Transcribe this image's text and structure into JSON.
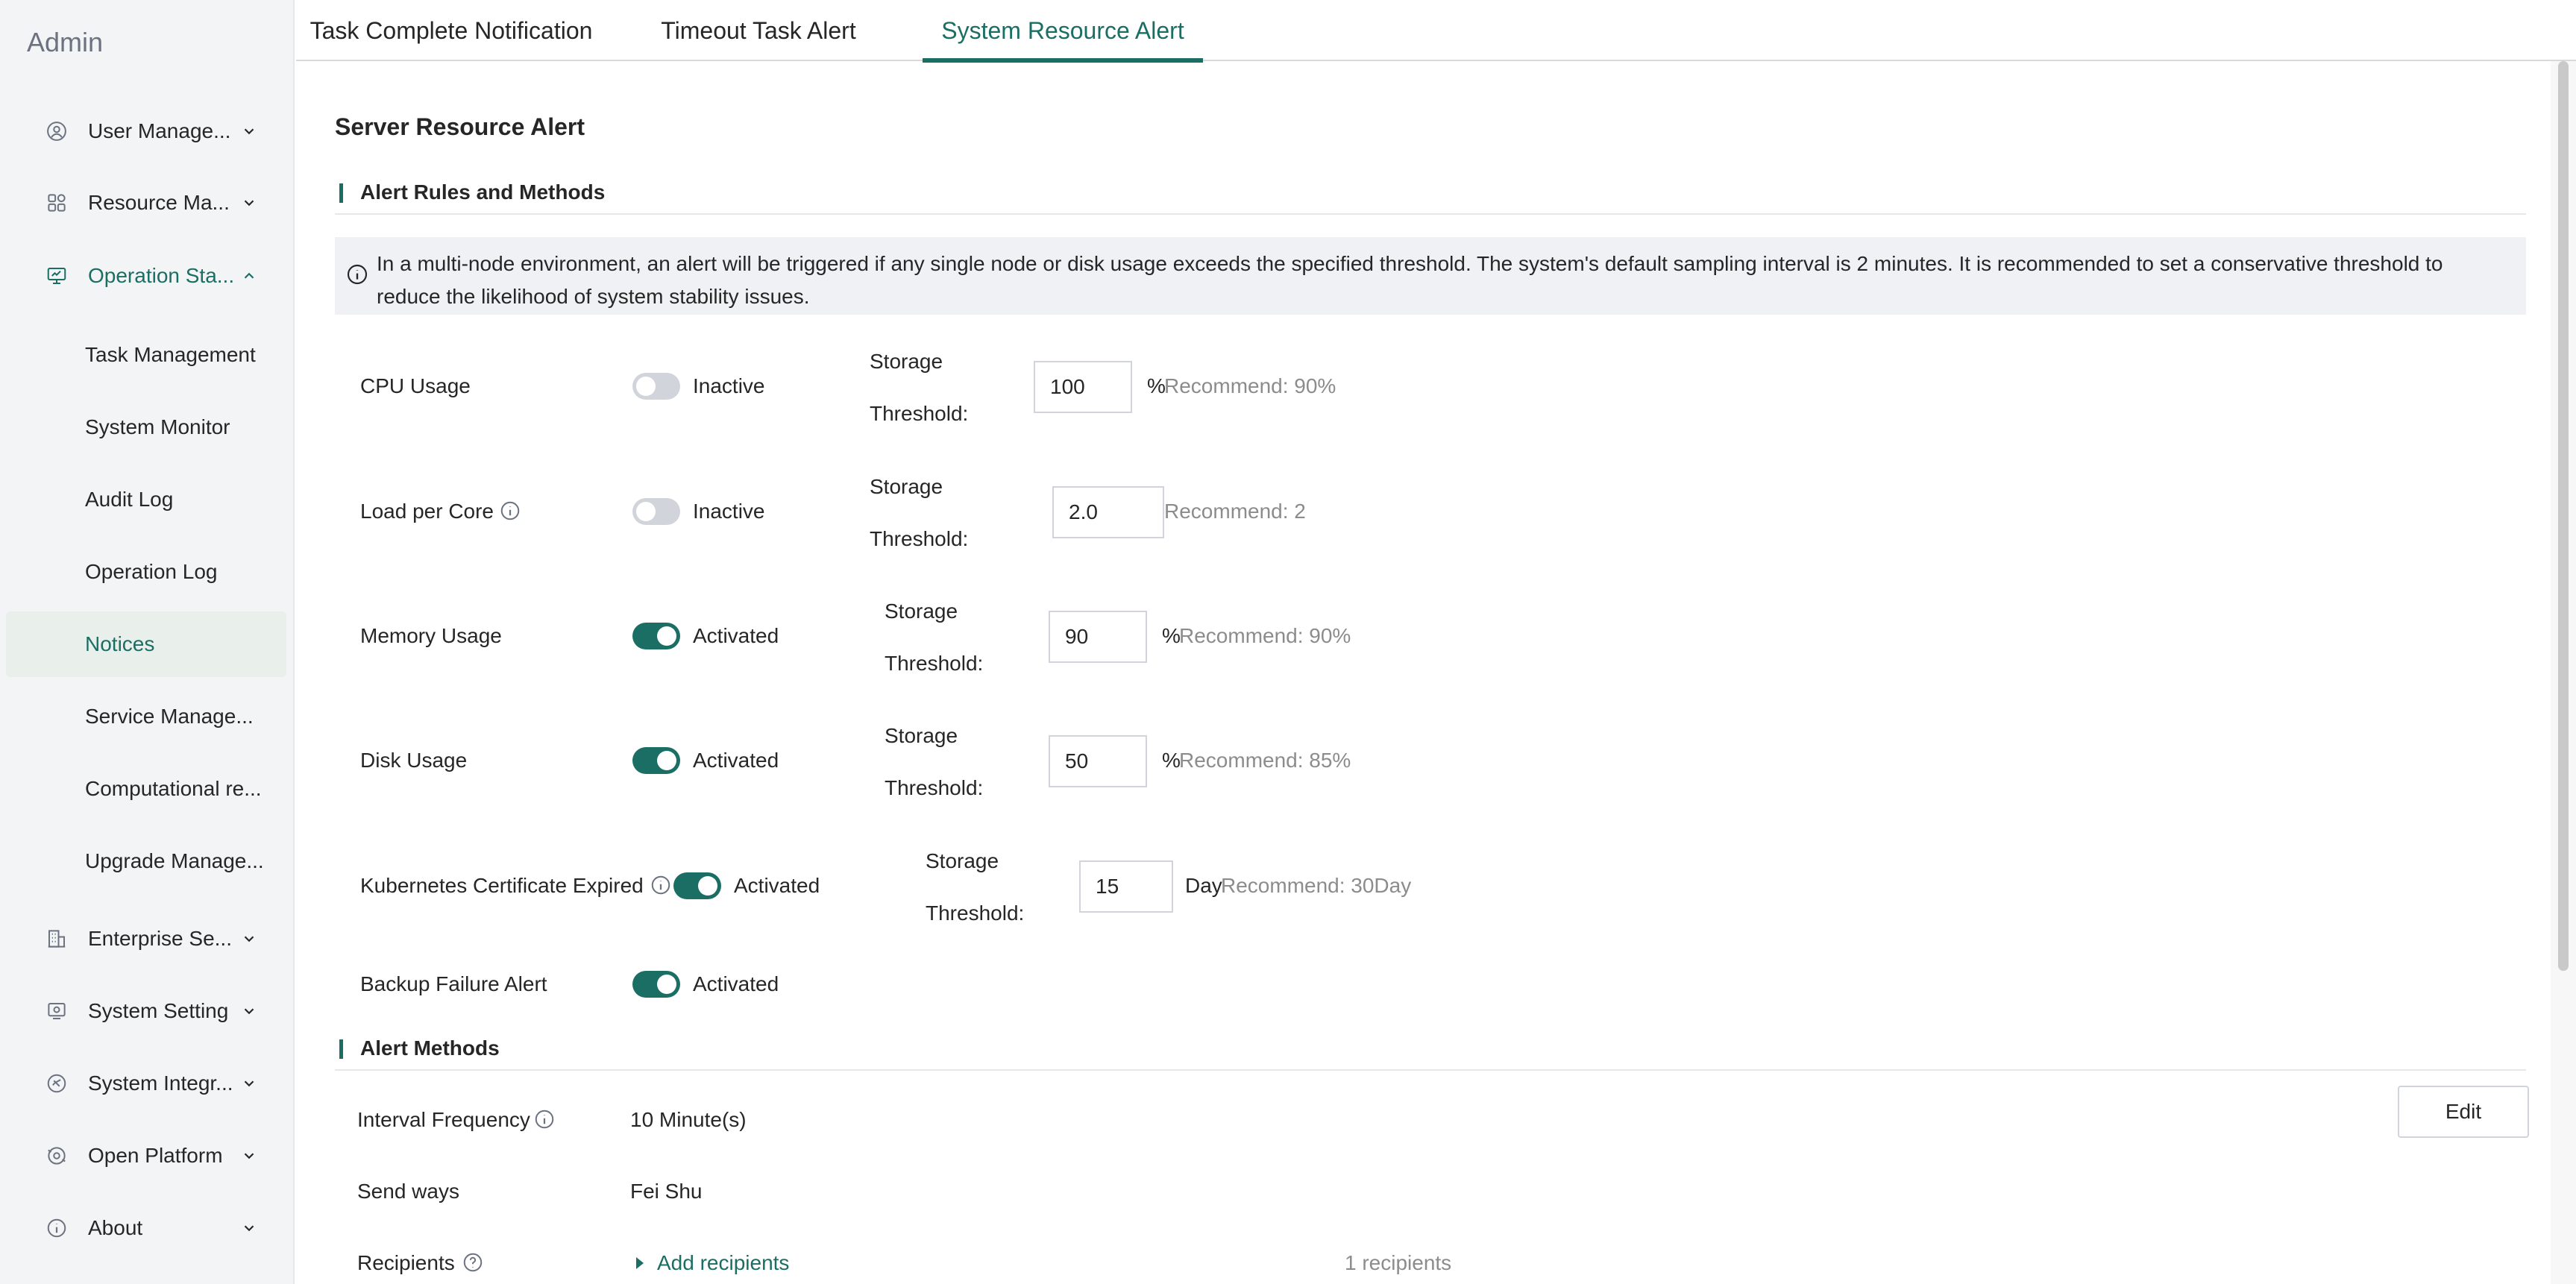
{
  "sidebar": {
    "brand": "Admin",
    "items": [
      {
        "label": "User Manage...",
        "icon": "user-circle-icon",
        "expanded": false
      },
      {
        "label": "Resource Ma...",
        "icon": "grid-icon",
        "expanded": false
      },
      {
        "label": "Operation Sta...",
        "icon": "monitor-icon",
        "expanded": true
      },
      {
        "label": "Enterprise Se...",
        "icon": "building-icon",
        "expanded": false
      },
      {
        "label": "System Setting",
        "icon": "gear-icon",
        "expanded": false
      },
      {
        "label": "System Integr...",
        "icon": "integration-icon",
        "expanded": false
      },
      {
        "label": "Open Platform",
        "icon": "platform-icon",
        "expanded": false
      },
      {
        "label": "About",
        "icon": "info-icon",
        "expanded": false
      }
    ],
    "sub_items": [
      {
        "label": "Task Management"
      },
      {
        "label": "System Monitor"
      },
      {
        "label": "Audit Log"
      },
      {
        "label": "Operation Log"
      },
      {
        "label": "Notices",
        "active": true
      },
      {
        "label": "Service Manage..."
      },
      {
        "label": "Computational re..."
      },
      {
        "label": "Upgrade Manage..."
      }
    ]
  },
  "tabs": [
    {
      "label": "Task Complete Notification"
    },
    {
      "label": "Timeout Task Alert"
    },
    {
      "label": "System Resource Alert",
      "active": true
    }
  ],
  "page": {
    "title": "Server Resource Alert",
    "rules_section": "Alert Rules and Methods",
    "banner": "In a multi-node environment, an alert will be triggered if any single node or disk usage exceeds the specified threshold. The system's default sampling interval is 2 minutes. It is recommended to set a conservative threshold to reduce the likelihood of system stability issues.",
    "threshold_label_line1": "Storage",
    "threshold_label_line2": "Threshold:",
    "rules": [
      {
        "label": "CPU Usage",
        "on": false,
        "status": "Inactive",
        "value": "100",
        "unit": "%",
        "recommend": "Recommend: 90%"
      },
      {
        "label": "Load per Core",
        "on": false,
        "status": "Inactive",
        "value": "2.0",
        "unit": "",
        "recommend": "Recommend: 2"
      },
      {
        "label": "Memory Usage",
        "on": true,
        "status": "Activated",
        "value": "90",
        "unit": "%",
        "recommend": "Recommend: 90%"
      },
      {
        "label": "Disk Usage",
        "on": true,
        "status": "Activated",
        "value": "50",
        "unit": "%",
        "recommend": "Recommend: 85%"
      },
      {
        "label": "Kubernetes Certificate Expired",
        "on": true,
        "status": "Activated",
        "value": "15",
        "unit": "Day",
        "recommend": "Recommend: 30Day"
      },
      {
        "label": "Backup Failure Alert",
        "on": true,
        "status": "Activated"
      }
    ],
    "methods_section": "Alert Methods",
    "methods": {
      "interval_label": "Interval Frequency",
      "interval_value": "10 Minute(s)",
      "send_label": "Send ways",
      "send_value": "Fei Shu",
      "recipients_label": "Recipients",
      "add_recipients": "Add recipients",
      "recipients_count": "1 recipients"
    },
    "edit_label": "Edit"
  },
  "colors": {
    "accent": "#1a6e63",
    "sidebar_bg": "#f3f4f6",
    "banner_bg": "#f0f1f4",
    "toggle_off": "#d1d5db"
  }
}
